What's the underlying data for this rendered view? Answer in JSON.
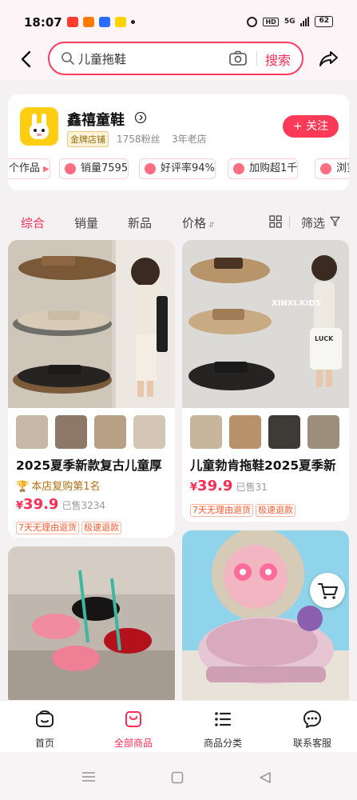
{
  "status_bar": {
    "time": "18:07",
    "network": "5G",
    "hd": "HD",
    "battery": "62"
  },
  "search": {
    "value": "儿童拖鞋",
    "button_label": "搜索"
  },
  "shop": {
    "name": "鑫禧童鞋",
    "badge": "金牌店铺",
    "fans": "1758粉丝",
    "years": "3年老店",
    "follow_label": "+ 关注",
    "chips": [
      {
        "label": "个作品"
      },
      {
        "label": "销量7595"
      },
      {
        "label": "好评率94%"
      },
      {
        "label": "加购超1千"
      },
      {
        "label": "浏览"
      }
    ]
  },
  "sort_tabs": {
    "items": [
      "综合",
      "销量",
      "新品",
      "价格"
    ],
    "active": "综合",
    "filter_label": "筛选"
  },
  "products": [
    {
      "title": "2025夏季新款复古儿童厚",
      "rank": "本店复购第1名",
      "currency": "¥",
      "price": "39.9",
      "sold": "已售3234",
      "tags": [
        "7天无理由退货",
        "极速退款"
      ]
    },
    {
      "title": "儿童勃肯拖鞋2025夏季新",
      "image_text": "XINXI.KIDS",
      "bag_text": "LUCK",
      "currency": "¥",
      "price": "39.9",
      "sold": "已售31",
      "tags": [
        "7天无理由退货",
        "极速退款"
      ]
    }
  ],
  "bottom_nav": [
    {
      "label": "首页",
      "icon": "home-icon"
    },
    {
      "label": "全部商品",
      "icon": "bag-icon",
      "active": true
    },
    {
      "label": "商品分类",
      "icon": "list-icon"
    },
    {
      "label": "联系客服",
      "icon": "chat-icon"
    }
  ],
  "colors": {
    "accent": "#ff2d55",
    "gold": "#ffce12"
  }
}
